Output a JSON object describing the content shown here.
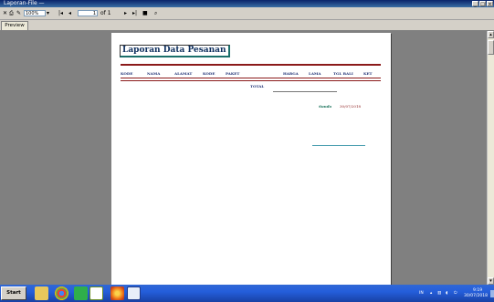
{
  "window": {
    "title": "Laporan-File —",
    "min": "_",
    "max": "□",
    "close": "×"
  },
  "toolbar": {
    "zoom": "100%",
    "page_current": "1",
    "page_total": "of 1"
  },
  "tabs": [
    {
      "label": "Preview"
    }
  ],
  "report": {
    "title": "Laporan Data Pesanan",
    "columns": [
      "KODE",
      "NAMA",
      "ALAMAT",
      "KODE",
      "PAKET",
      "HARGA",
      "LAMA",
      "TGL BALI",
      "KET"
    ],
    "total_label": "TOTAL",
    "city": "Sunda",
    "date": "30/07/2018"
  },
  "taskbar": {
    "start_label": "Start",
    "lang": "IN",
    "time": "9:19",
    "date": "30/07/2018"
  }
}
